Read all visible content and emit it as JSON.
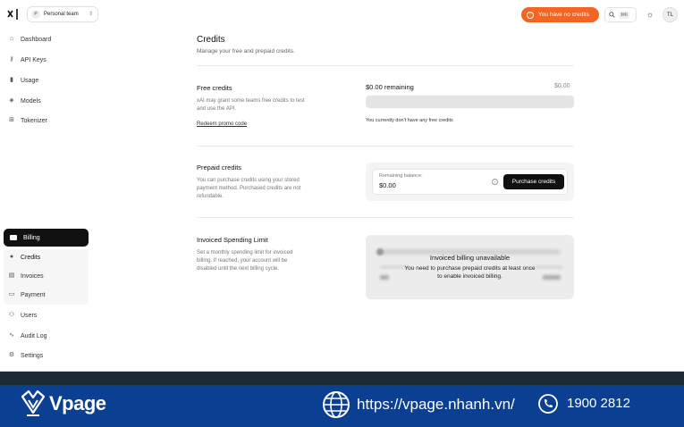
{
  "topbar": {
    "team_avatar": "P",
    "team_name": "Personal team",
    "no_credits": "You have no credits",
    "search_shortcut": "⌘K",
    "user_initials": "TL"
  },
  "sidebar": {
    "items": [
      {
        "label": "Dashboard",
        "icon": "home-icon"
      },
      {
        "label": "API Keys",
        "icon": "key-icon"
      },
      {
        "label": "Usage",
        "icon": "bar-chart-icon"
      },
      {
        "label": "Models",
        "icon": "cube-icon"
      },
      {
        "label": "Tokenizer",
        "icon": "grid-icon"
      }
    ],
    "billing": "Billing",
    "billing_sub": [
      {
        "label": "Credits",
        "icon": "dot-icon"
      },
      {
        "label": "Invoices",
        "icon": "document-icon"
      },
      {
        "label": "Payment",
        "icon": "card-icon"
      }
    ],
    "bottom": [
      {
        "label": "Users",
        "icon": "users-icon"
      },
      {
        "label": "Audit Log",
        "icon": "activity-icon"
      },
      {
        "label": "Settings",
        "icon": "gear-icon"
      }
    ]
  },
  "page": {
    "title": "Credits",
    "subtitle": "Manage your free and prepaid credits."
  },
  "free_credits": {
    "title": "Free credits",
    "description": "xAI may grant some teams free credits to test and use the API.",
    "redeem_link": "Redeem promo code",
    "remaining": "$0.00 remaining",
    "amount": "$0.00",
    "used_fraction": 0,
    "none_text": "You currently don't have any free credits"
  },
  "prepaid_credits": {
    "title": "Prepaid credits",
    "description": "You can purchase credits using your stored payment method. Purchased credits are not refundable.",
    "balance_label": "Remaining balance:",
    "balance_value": "$0.00",
    "purchase_button": "Purchase credits"
  },
  "invoiced": {
    "title": "Invoiced Spending Limit",
    "description": "Set a monthly spending limit for invoiced billing. If reached, your account will be disabled until the next billing cycle.",
    "unavailable_title": "Invoiced billing unavailable",
    "unavailable_message": "You need to purchase prepaid credits at least once to enable invoiced billing."
  },
  "banner": {
    "brand": "Vpage",
    "url": "https://vpage.nhanh.vn/",
    "phone": "1900 2812"
  },
  "colors": {
    "accent_orange": "#f26522",
    "banner_blue": "#0b3f91",
    "primary_button": "#111111"
  }
}
